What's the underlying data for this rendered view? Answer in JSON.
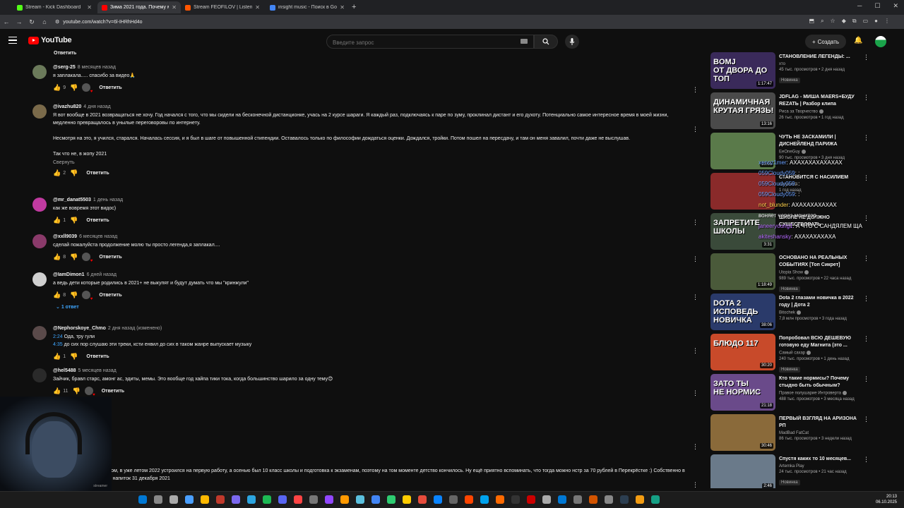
{
  "browser": {
    "tabs": [
      {
        "label": "Stream - Kick Dashboard",
        "color": "#53fc18",
        "active": false
      },
      {
        "label": "Зима 2021 года. Почему мы в...",
        "color": "#ff0000",
        "active": true
      },
      {
        "label": "Stream FEOFILOV | Listen to m...",
        "color": "#ff5500",
        "active": false
      },
      {
        "label": "insight music - Поиск в Google",
        "color": "#4285f4",
        "active": false
      }
    ],
    "new_tab": "+",
    "url": "youtube.com/watch?v=6l-IHRhHd4o"
  },
  "header": {
    "logo_text": "YouTube",
    "search_placeholder": "Введите запрос",
    "create_label": "Создать"
  },
  "top_reply_label": "Ответить",
  "comments": [
    {
      "author": "@serg-25",
      "date": "8 месяцев назад",
      "text": "я заплакала..... спасибо за видео🙏",
      "likes": "9",
      "heart": true,
      "reply": "Ответить",
      "avatar": "#6b7a5a"
    },
    {
      "author": "@ivazhu820",
      "date": "4 дня назад",
      "text": "Я вот вообще в 2021 возвращаться не хочу. Год начался с того, что мы сидели на бесконечной дистанционке, учась на 2 курсе шараги. Я каждый раз, подключаясь к паре по зуму, проклинал дистант и его духоту. Потенциально самое интересное время в моей жизни, медленно превращалось в унылые переговоровы по интернету.\n\nНесмотря на это, я учился, старался. Началась сессия, и я был в шаге от повышенной стипендии. Оставалось только по философии дождаться оценки. Дождался, тройки. Потом пошел на пересдачу, и там он меня завалил, почти даже не выслушав.\n\nТак что не, в жопу 2021",
      "collapse": "Свернуть",
      "likes": "2",
      "heart": false,
      "reply": "Ответить",
      "avatar": "#7a6a4a"
    },
    {
      "author": "@mr_danat5503",
      "date": "1 день назад",
      "text": "как же вовремя этот видос)",
      "likes": "1",
      "heart": false,
      "reply": "Ответить",
      "avatar": "#c03aa0"
    },
    {
      "author": "@xxll9039",
      "date": "6 месяцев назад",
      "text": "сделай пожалуйста продолжение молю ты просто легенда,я заплакал....",
      "likes": "8",
      "heart": true,
      "reply": "Ответить",
      "avatar": "#8a3a6a"
    },
    {
      "author": "@IamDimon1",
      "date": "6 дней назад",
      "text": "а ведь дети которые родились в 2021+ не выкупят и будут думать что мы \"кринжули\"",
      "likes": "8",
      "heart": true,
      "reply": "Ответить",
      "replies": "1 ответ",
      "avatar": "#d0d0d0"
    },
    {
      "author": "@Nephorskoye_Chmo",
      "date": "2 дня назад (изменено)",
      "text_parts": [
        {
          "time": "2:24",
          "rest": " Ода, тру гули"
        },
        {
          "time": "4:35",
          "rest": " до сих пор слушаю эти треки, ксти енвил до сих в таком жанре выпускает музыку"
        }
      ],
      "likes": "1",
      "heart": false,
      "reply": "Ответить",
      "avatar": "#5a4a4a"
    },
    {
      "author": "@hel5488",
      "date": "5 месяцев назад",
      "text": "Зайчик, бравл старс, амонг ас, эдиты, мемы. Это вообще год хайпа тики тока, когда большинство шарило за одну тему😊",
      "likes": "11",
      "heart": true,
      "reply": "Ответить",
      "avatar": "#2a2a2a"
    },
    {
      "author": "",
      "date": "назад",
      "text": "ся возродить 2021 еее",
      "reply": "Ответить",
      "avatar": "#1a1a1a"
    },
    {
      "author": "",
      "date": "назад (изменено)",
      "text": "чтото тогда я был ребёнком, в уже летом 2022 устроился на первую работу, а осенью был 10 класс школы и подготовка к экзаменам, поэтому на том моменте детство кончилось. Ну ещё приятно вспоминать, что тогда можно нстр за 70 рублей в Перекрёстке :) Собственно в последний раз я пил этот напиток 31 декабря 2021",
      "avatar": "#1a1a1a"
    }
  ],
  "webcam_label": "streamer",
  "sidebar_videos": [
    {
      "title": "СТАНОВЛЕНИЕ ЛЕГЕНДЫ: ...",
      "channel": "хто",
      "verified": false,
      "stats": "45 тыс. просмотров • 2 дня назад",
      "badge": "Новинка",
      "duration": "1:17:47",
      "thumb_text": "BOMJ\nОТ ДВОРА ДО ТОП",
      "thumb_color": "#3a2a5a"
    },
    {
      "title": "JDFLAG - МИША MAERS+БУДУ REZATЬ | Разбор клипа",
      "channel": "Риса за Творчество",
      "verified": true,
      "stats": "26 тыс. просмотров • 1 год назад",
      "badge": "",
      "duration": "13:16",
      "thumb_text": "ДИНАМИЧНАЯ\nКРУТАЯ ГРЯЗЬ!",
      "thumb_color": "#4a4a4a"
    },
    {
      "title": "ЧУТЬ НЕ ЗАСКАМИЛИ | ДИСНЕЙЛЕНД ПАРИЖА",
      "channel": "EeOneGuy",
      "verified": true,
      "stats": "90 тыс. просмотров • 3 дня назад",
      "badge": "",
      "duration": "10:01",
      "thumb_text": "",
      "thumb_color": "#5a7a4a"
    },
    {
      "title": "СТАНОВИТСЯ С НАСИЛИЕМ",
      "channel": "какую404",
      "verified": false,
      "stats": "1 год назад",
      "badge": "",
      "duration": "",
      "thumb_text": "",
      "thumb_color": "#8a2a2a"
    },
    {
      "title": "ШКОЛЕ НЕ ДОЛЖНО СУЩЕСТВОВАТЬ",
      "channel": "",
      "verified": false,
      "stats": "",
      "badge": "",
      "duration": "3:31",
      "thumb_text": "ЗАПРЕТИТЕ\nШКОЛЫ",
      "thumb_color": "#3a4a3a"
    },
    {
      "title": "ОСНОВАНО НА РЕАЛЬНЫХ СОБЫТИЯХ [Топ Сикрет]",
      "channel": "Utopia Show",
      "verified": true,
      "stats": "989 тыс. просмотров • 22 часа назад",
      "badge": "Новинка",
      "duration": "1:18:49",
      "thumb_text": "",
      "thumb_color": "#4a5a3a"
    },
    {
      "title": "Dota 2 глазами новичка в 2022 году | Дота 2",
      "channel": "Bitochek",
      "verified": true,
      "stats": "7,8 млн просмотров • 3 года назад",
      "badge": "",
      "duration": "38:06",
      "thumb_text": "DOTA 2\nИСПОВЕДЬ\nНОВИЧКА",
      "thumb_color": "#2a3a6a"
    },
    {
      "title": "Попробовал ВСЮ ДЕШЕВУЮ готовую еду Магнита (это ...",
      "channel": "Самый сахар",
      "verified": true,
      "stats": "240 тыс. просмотров • 1 день назад",
      "badge": "Новинка",
      "duration": "30:20",
      "thumb_text": "БЛЮДО 117",
      "thumb_color": "#c84a2a"
    },
    {
      "title": "Кто такие нормисы? Почему стыдно быть обычным?",
      "channel": "Правое полушарие Интроверта",
      "verified": true,
      "stats": "488 тыс. просмотров • 3 месяца назад",
      "badge": "",
      "duration": "21:18",
      "thumb_text": "ЗАТО ТЫ\nНЕ НОРМИС",
      "thumb_color": "#6a4a8a"
    },
    {
      "title": "ПЕРВЫЙ ВЗГЛЯД НА АРИЗОНА РП",
      "channel": "MadBad FatCat",
      "verified": false,
      "stats": "86 тыс. просмотров • 3 недели назад",
      "badge": "",
      "duration": "30:46",
      "thumb_text": "",
      "thumb_color": "#8a6a3a"
    },
    {
      "title": "Спустя каких то 10 месяцев...",
      "channel": "Artemka Play",
      "verified": false,
      "stats": "24 тыс. просмотров • 21 час назад",
      "badge": "Новинка",
      "duration": "2:46",
      "thumb_text": "",
      "thumb_color": "#6a7a8a"
    }
  ],
  "chat": [
    {
      "user": "xenoz1mer",
      "text": "АХАХАХАХАХАХАХ",
      "color": "#6aa0ff"
    },
    {
      "user": "059Cloudy059",
      "text": ":",
      "color": "#6aa0ff"
    },
    {
      "user": "059Cloudy059",
      "text": ":",
      "color": "#6aa0ff"
    },
    {
      "user": "059Cloudy059",
      "text": ":",
      "color": "#6aa0ff"
    },
    {
      "user": "not_blunder",
      "text": "АХАХАХАХАХАХ",
      "color": "#ffd24d"
    },
    {
      "user": "",
      "text": "воняет через монитор",
      "color": "#6aa0ff"
    },
    {
      "user": "janeeryoung1",
      "text": "А ЧТО С САНДЯЛЕМ ЩА",
      "color": "#b66bff"
    },
    {
      "user": "akiteshansky",
      "text": "АХАХАХАХАХА",
      "color": "#b66bff"
    }
  ],
  "clock": {
    "time": "20:13",
    "date": "06.10.2025"
  }
}
